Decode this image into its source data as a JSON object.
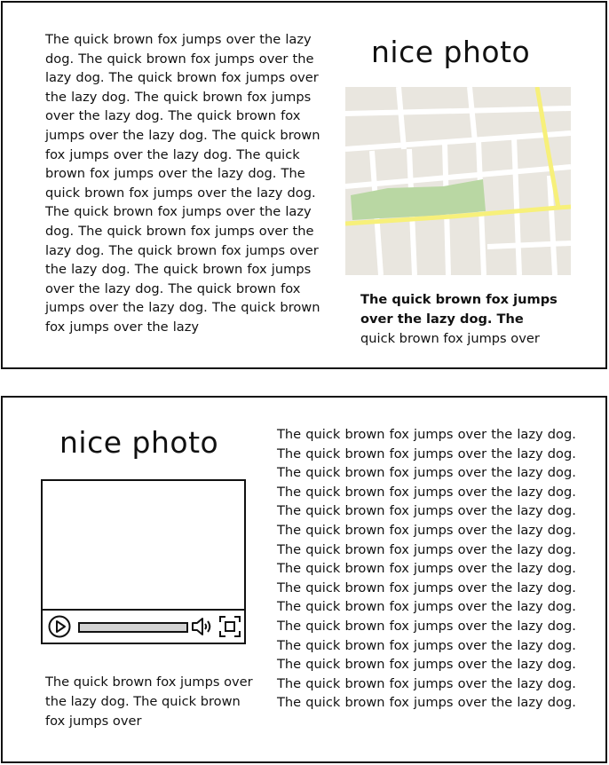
{
  "card1": {
    "paragraph": "The quick brown fox jumps over the lazy dog. The quick brown fox jumps over the lazy dog. The quick brown fox jumps over the lazy dog. The quick brown fox jumps over the lazy dog. The quick brown fox jumps over the lazy dog. The quick brown fox jumps over the lazy dog. The quick brown fox jumps over the lazy dog. The quick brown fox jumps over the lazy dog. The quick brown fox jumps over the lazy dog. The quick brown fox jumps over the lazy dog. The quick brown fox jumps over the lazy dog. The quick brown fox jumps over the lazy dog. The quick brown fox jumps over the lazy dog. The quick brown fox jumps over the lazy",
    "heading": "nice photo",
    "image_icon": "map-image",
    "caption_bold": "The quick brown fox jumps over the lazy dog. The",
    "caption_normal": "quick brown fox jumps over"
  },
  "card2": {
    "heading": "nice photo",
    "video_icons": [
      "play-icon",
      "volume-icon",
      "fullscreen-icon"
    ],
    "caption": "The quick brown fox jumps over the lazy dog. The quick brown fox jumps over",
    "paragraph": "The quick brown fox jumps over the lazy dog. The quick brown fox jumps over the lazy dog. The quick brown fox jumps over the lazy dog. The quick brown fox jumps over the lazy dog. The quick brown fox jumps over the lazy dog. The quick brown fox jumps over the lazy dog. The quick brown fox jumps over the lazy dog. The quick brown fox jumps over the lazy dog. The quick brown fox jumps over the lazy dog. The quick brown fox jumps over the lazy dog. The quick brown fox jumps over the lazy dog. The quick brown fox jumps over the lazy dog. The quick brown fox jumps over the lazy dog. The quick brown fox jumps over the lazy dog. The quick brown fox jumps over the lazy dog."
  },
  "colors": {
    "border": "#111111",
    "map_bg": "#e9e6df",
    "map_road": "#ffffff",
    "map_highway": "#f7f07a",
    "map_park": "#b9d7a3",
    "progress_fill": "#d3d3d3"
  }
}
